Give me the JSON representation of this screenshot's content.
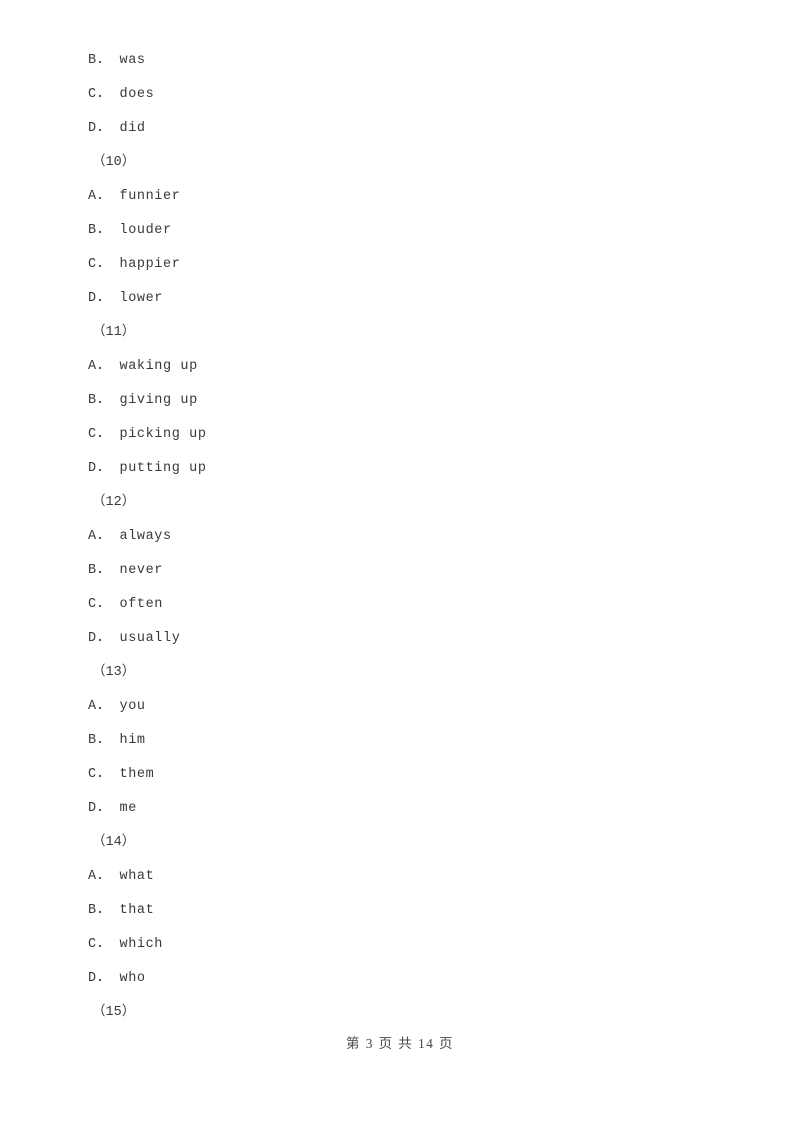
{
  "document": {
    "page_background": "#ffffff",
    "text_color": "#3a3a3a",
    "lines": [
      {
        "kind": "option",
        "text": "B． was"
      },
      {
        "kind": "option",
        "text": "C． does"
      },
      {
        "kind": "option",
        "text": "D． did"
      },
      {
        "kind": "qnum",
        "text": "（10）"
      },
      {
        "kind": "option",
        "text": "A． funnier"
      },
      {
        "kind": "option",
        "text": "B． louder"
      },
      {
        "kind": "option",
        "text": "C． happier"
      },
      {
        "kind": "option",
        "text": "D． lower"
      },
      {
        "kind": "qnum",
        "text": "（11）"
      },
      {
        "kind": "option",
        "text": "A． waking up"
      },
      {
        "kind": "option",
        "text": "B． giving up"
      },
      {
        "kind": "option",
        "text": "C． picking up"
      },
      {
        "kind": "option",
        "text": "D． putting up"
      },
      {
        "kind": "qnum",
        "text": "（12）"
      },
      {
        "kind": "option",
        "text": "A． always"
      },
      {
        "kind": "option",
        "text": "B． never"
      },
      {
        "kind": "option",
        "text": "C． often"
      },
      {
        "kind": "option",
        "text": "D． usually"
      },
      {
        "kind": "qnum",
        "text": "（13）"
      },
      {
        "kind": "option",
        "text": "A． you"
      },
      {
        "kind": "option",
        "text": "B． him"
      },
      {
        "kind": "option",
        "text": "C． them"
      },
      {
        "kind": "option",
        "text": "D． me"
      },
      {
        "kind": "qnum",
        "text": "（14）"
      },
      {
        "kind": "option",
        "text": "A． what"
      },
      {
        "kind": "option",
        "text": "B． that"
      },
      {
        "kind": "option",
        "text": "C． which"
      },
      {
        "kind": "option",
        "text": "D． who"
      },
      {
        "kind": "qnum",
        "text": "（15）"
      }
    ]
  },
  "footer": {
    "page_label": "第 3 页 共 14 页",
    "current_page": 3,
    "total_pages": 14
  }
}
